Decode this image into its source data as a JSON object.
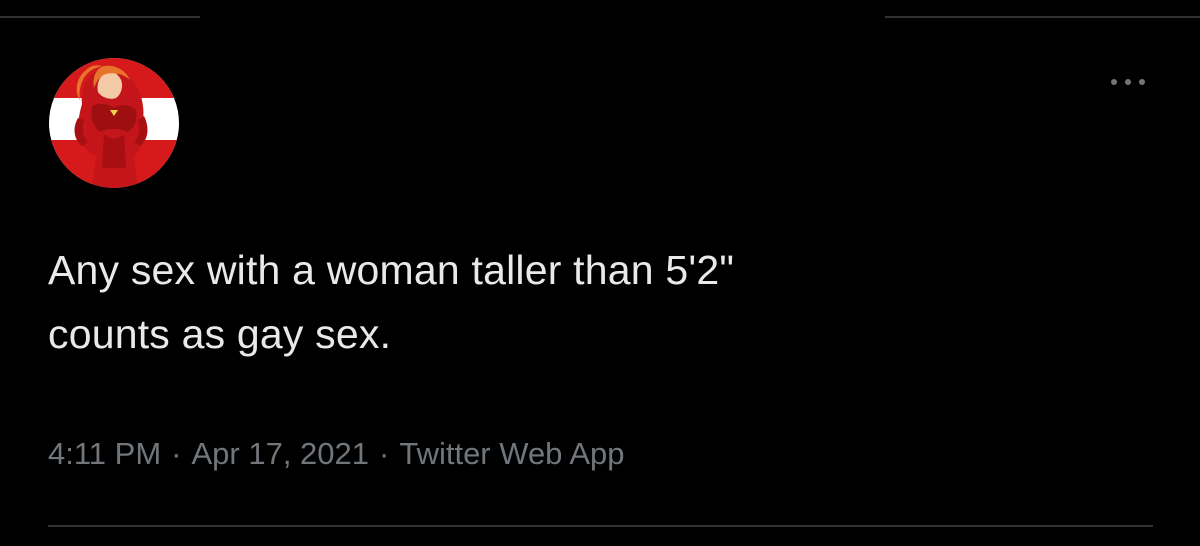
{
  "tweet": {
    "text_lines": [
      "Any sex with a woman taller than 5'2\"",
      "counts as gay sex."
    ],
    "time": "4:11 PM",
    "date": "Apr 17, 2021",
    "source": "Twitter Web App",
    "separator": "·"
  },
  "header": {
    "more_icon": "more-horizontal-icon"
  },
  "colors": {
    "background": "#000000",
    "text": "#e7e9ea",
    "secondary_text": "#71767b",
    "divider": "#2f3336",
    "avatar_red": "#d6191b"
  }
}
